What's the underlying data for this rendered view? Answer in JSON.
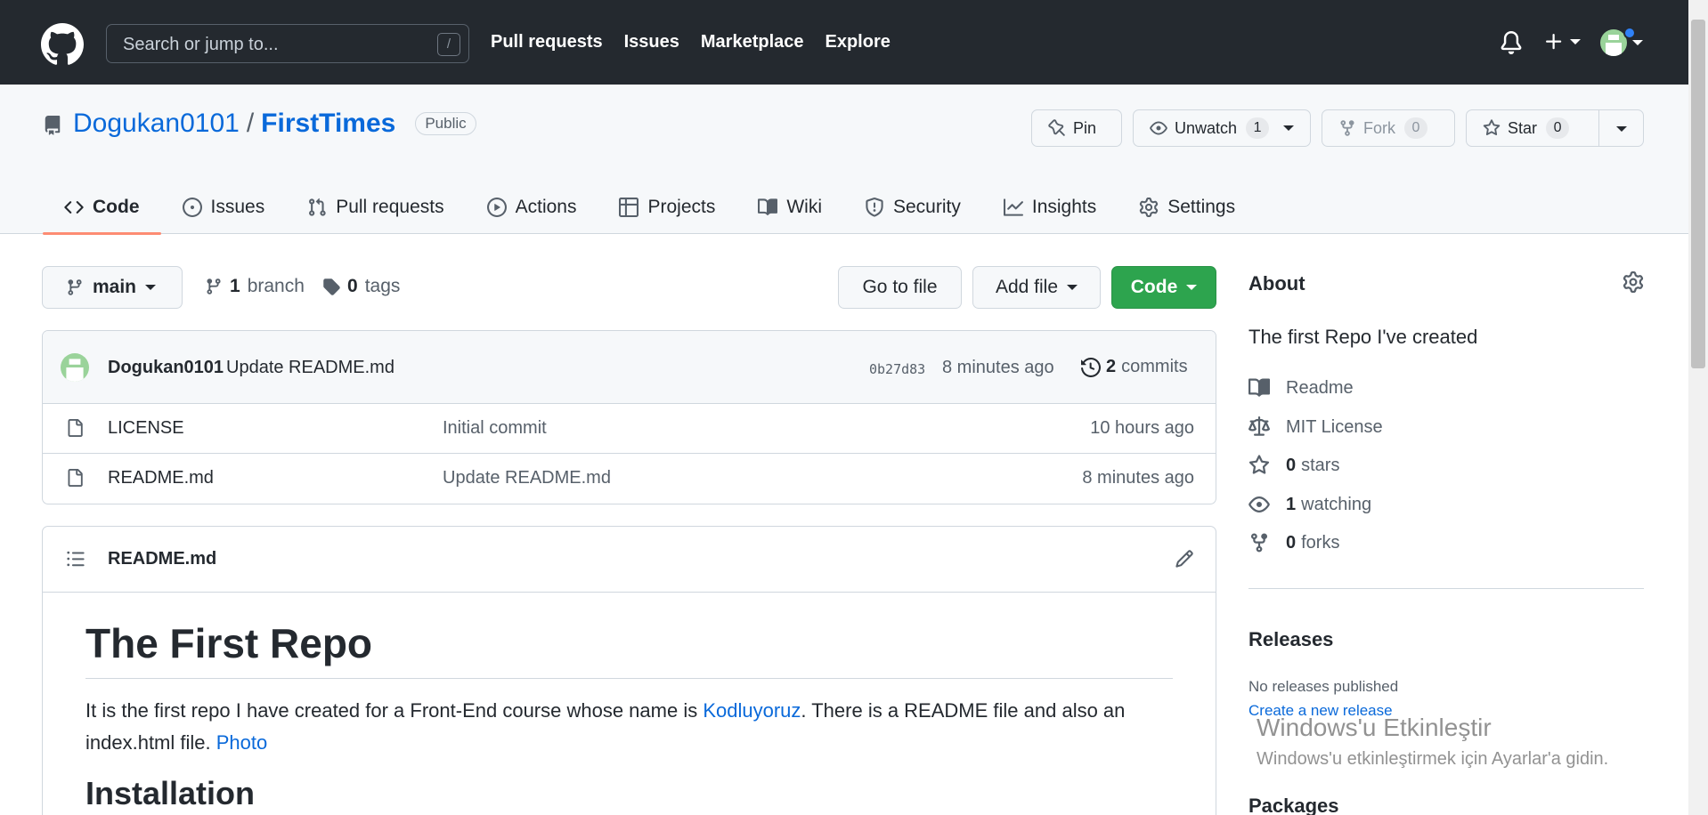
{
  "header": {
    "search_placeholder": "Search or jump to...",
    "search_shortcut": "/",
    "nav": [
      "Pull requests",
      "Issues",
      "Marketplace",
      "Explore"
    ]
  },
  "repo": {
    "owner": "Dogukan0101",
    "separator": "/",
    "name": "FirstTimes",
    "visibility": "Public",
    "pin_label": "Pin",
    "watch_label": "Unwatch",
    "watch_count": "1",
    "fork_label": "Fork",
    "fork_count": "0",
    "star_label": "Star",
    "star_count": "0"
  },
  "tabs": [
    {
      "label": "Code",
      "icon": "code-icon"
    },
    {
      "label": "Issues",
      "icon": "issue-icon"
    },
    {
      "label": "Pull requests",
      "icon": "pull-request-icon"
    },
    {
      "label": "Actions",
      "icon": "play-icon"
    },
    {
      "label": "Projects",
      "icon": "table-icon"
    },
    {
      "label": "Wiki",
      "icon": "book-icon"
    },
    {
      "label": "Security",
      "icon": "shield-icon"
    },
    {
      "label": "Insights",
      "icon": "graph-icon"
    },
    {
      "label": "Settings",
      "icon": "gear-icon"
    }
  ],
  "toolbar": {
    "branch": "main",
    "branch_count": "1",
    "branch_label": "branch",
    "tag_count": "0",
    "tag_label": "tags",
    "go_to_file": "Go to file",
    "add_file": "Add file",
    "code": "Code"
  },
  "commit": {
    "author": "Dogukan0101",
    "message": "Update README.md",
    "sha": "0b27d83",
    "time": "8 minutes ago",
    "count": "2",
    "count_label": "commits"
  },
  "files": [
    {
      "name": "LICENSE",
      "message": "Initial commit",
      "time": "10 hours ago"
    },
    {
      "name": "README.md",
      "message": "Update README.md",
      "time": "8 minutes ago"
    }
  ],
  "readme": {
    "filename": "README.md",
    "heading": "The First Repo",
    "p_before": "It is the first repo I have created for a Front-End course whose name is ",
    "link1": "Kodluyoruz",
    "p_middle": ". There is a README file and also an index.html file. ",
    "link2": "Photo",
    "next_heading": "Installation"
  },
  "about": {
    "title": "About",
    "description": "The first Repo I've created",
    "readme": "Readme",
    "license": "MIT License",
    "stars_count": "0",
    "stars_label": "stars",
    "watching_count": "1",
    "watching_label": "watching",
    "forks_count": "0",
    "forks_label": "forks"
  },
  "releases": {
    "title": "Releases",
    "none": "No releases published",
    "create": "Create a new release"
  },
  "packages": {
    "title": "Packages"
  },
  "watermark": {
    "title": "Windows'u Etkinleştir",
    "subtitle": "Windows'u etkinleştirmek için Ayarlar'a gidin."
  },
  "colors": {
    "header_bg": "#24292f",
    "link": "#0969da",
    "code_button": "#2da44e",
    "active_tab_underline": "#fd8c73"
  }
}
